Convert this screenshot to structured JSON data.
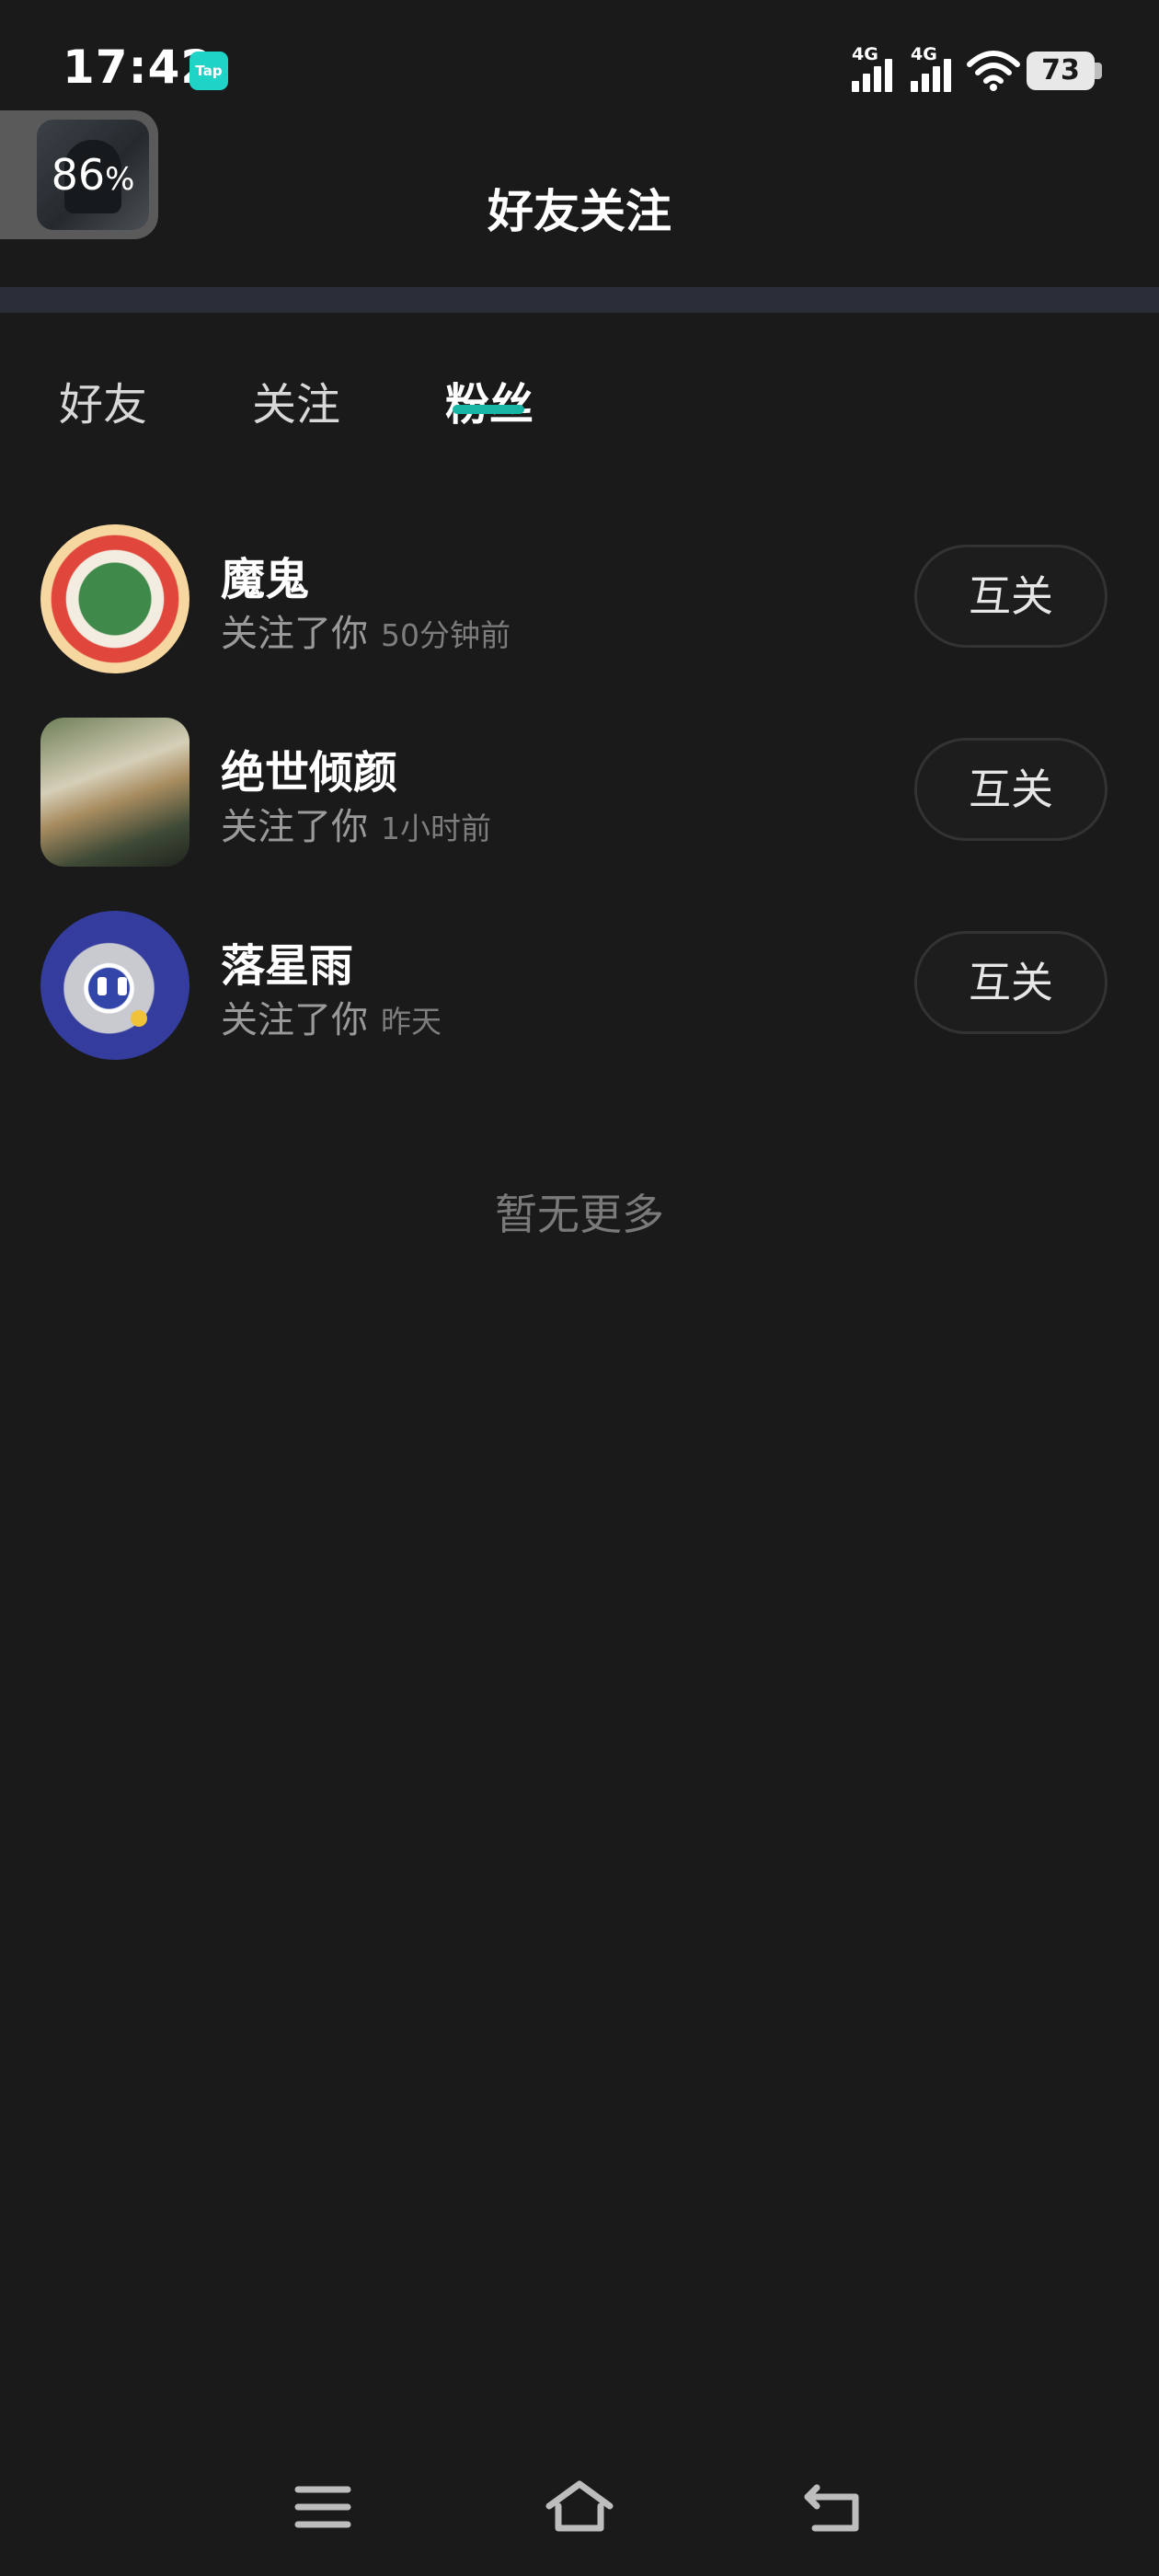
{
  "status_bar": {
    "time": "17:42",
    "app_badge": "Tap",
    "network_1": "4G",
    "network_2": "4G",
    "battery": "73"
  },
  "float_widget": {
    "percent": "86",
    "percent_sign": "%"
  },
  "header": {
    "title": "好友关注"
  },
  "tabs": [
    {
      "label": "好友"
    },
    {
      "label": "关注"
    },
    {
      "label": "粉丝"
    }
  ],
  "active_tab": "粉丝",
  "fans": [
    {
      "name": "魔鬼",
      "action": "关注了你",
      "time": "50分钟前",
      "button": "互关"
    },
    {
      "name": "绝世倾颜",
      "action": "关注了你",
      "time": "1小时前",
      "button": "互关"
    },
    {
      "name": "落星雨",
      "action": "关注了你",
      "time": "昨天",
      "button": "互关"
    }
  ],
  "footer_text": "暂无更多",
  "colors": {
    "background": "#1a1a1a",
    "accent": "#16b5a4",
    "divider": "#2a2e38"
  }
}
